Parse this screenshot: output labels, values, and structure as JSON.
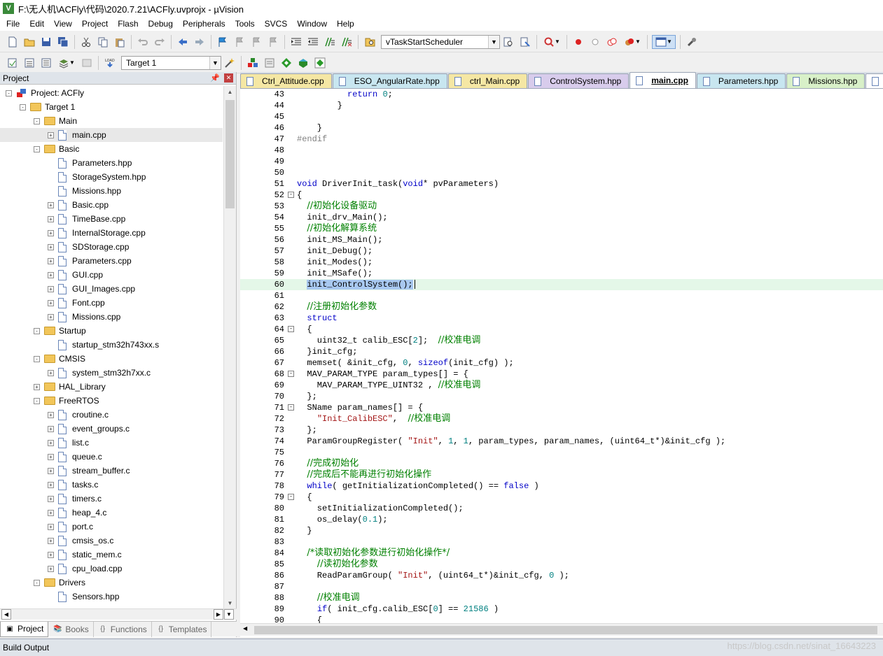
{
  "window": {
    "title": "F:\\无人机\\ACFly\\代码\\2020.7.21\\ACFly.uvprojx - µVision",
    "app_icon": "V"
  },
  "menu": [
    "File",
    "Edit",
    "View",
    "Project",
    "Flash",
    "Debug",
    "Peripherals",
    "Tools",
    "SVCS",
    "Window",
    "Help"
  ],
  "toolbar": {
    "function_combo": "vTaskStartScheduler",
    "target_combo": "Target 1"
  },
  "project_panel": {
    "title": "Project",
    "tabs": [
      "Project",
      "Books",
      "Functions",
      "Templates"
    ],
    "tree": [
      {
        "depth": 0,
        "exp": "-",
        "kind": "project",
        "label": "Project: ACFly"
      },
      {
        "depth": 1,
        "exp": "-",
        "kind": "target",
        "label": "Target 1"
      },
      {
        "depth": 2,
        "exp": "-",
        "kind": "folder",
        "label": "Main"
      },
      {
        "depth": 3,
        "exp": "+",
        "kind": "file",
        "label": "main.cpp",
        "selected": true
      },
      {
        "depth": 2,
        "exp": "-",
        "kind": "folder",
        "label": "Basic"
      },
      {
        "depth": 3,
        "exp": "",
        "kind": "file",
        "label": "Parameters.hpp"
      },
      {
        "depth": 3,
        "exp": "",
        "kind": "file",
        "label": "StorageSystem.hpp"
      },
      {
        "depth": 3,
        "exp": "",
        "kind": "file",
        "label": "Missions.hpp"
      },
      {
        "depth": 3,
        "exp": "+",
        "kind": "file",
        "label": "Basic.cpp"
      },
      {
        "depth": 3,
        "exp": "+",
        "kind": "file",
        "label": "TimeBase.cpp"
      },
      {
        "depth": 3,
        "exp": "+",
        "kind": "file",
        "label": "InternalStorage.cpp"
      },
      {
        "depth": 3,
        "exp": "+",
        "kind": "file",
        "label": "SDStorage.cpp"
      },
      {
        "depth": 3,
        "exp": "+",
        "kind": "file",
        "label": "Parameters.cpp"
      },
      {
        "depth": 3,
        "exp": "+",
        "kind": "file",
        "label": "GUI.cpp"
      },
      {
        "depth": 3,
        "exp": "+",
        "kind": "file",
        "label": "GUI_Images.cpp"
      },
      {
        "depth": 3,
        "exp": "+",
        "kind": "file",
        "label": "Font.cpp"
      },
      {
        "depth": 3,
        "exp": "+",
        "kind": "file",
        "label": "Missions.cpp"
      },
      {
        "depth": 2,
        "exp": "-",
        "kind": "folder",
        "label": "Startup"
      },
      {
        "depth": 3,
        "exp": "",
        "kind": "file",
        "label": "startup_stm32h743xx.s"
      },
      {
        "depth": 2,
        "exp": "-",
        "kind": "folder",
        "label": "CMSIS"
      },
      {
        "depth": 3,
        "exp": "+",
        "kind": "file",
        "label": "system_stm32h7xx.c"
      },
      {
        "depth": 2,
        "exp": "+",
        "kind": "folder",
        "label": "HAL_Library"
      },
      {
        "depth": 2,
        "exp": "-",
        "kind": "folder",
        "label": "FreeRTOS"
      },
      {
        "depth": 3,
        "exp": "+",
        "kind": "file",
        "label": "croutine.c"
      },
      {
        "depth": 3,
        "exp": "+",
        "kind": "file",
        "label": "event_groups.c"
      },
      {
        "depth": 3,
        "exp": "+",
        "kind": "file",
        "label": "list.c"
      },
      {
        "depth": 3,
        "exp": "+",
        "kind": "file",
        "label": "queue.c"
      },
      {
        "depth": 3,
        "exp": "+",
        "kind": "file",
        "label": "stream_buffer.c"
      },
      {
        "depth": 3,
        "exp": "+",
        "kind": "file",
        "label": "tasks.c"
      },
      {
        "depth": 3,
        "exp": "+",
        "kind": "file",
        "label": "timers.c"
      },
      {
        "depth": 3,
        "exp": "+",
        "kind": "file",
        "label": "heap_4.c"
      },
      {
        "depth": 3,
        "exp": "+",
        "kind": "file",
        "label": "port.c"
      },
      {
        "depth": 3,
        "exp": "+",
        "kind": "file",
        "label": "cmsis_os.c"
      },
      {
        "depth": 3,
        "exp": "+",
        "kind": "file",
        "label": "static_mem.c"
      },
      {
        "depth": 3,
        "exp": "+",
        "kind": "file",
        "label": "cpu_load.cpp"
      },
      {
        "depth": 2,
        "exp": "-",
        "kind": "folder",
        "label": "Drivers"
      },
      {
        "depth": 3,
        "exp": "",
        "kind": "file",
        "label": "Sensors.hpp"
      }
    ]
  },
  "editor": {
    "tabs": [
      {
        "label": "Ctrl_Attitude.cpp",
        "color": "#f5e7a4"
      },
      {
        "label": "ESO_AngularRate.hpp",
        "color": "#c8e6f0"
      },
      {
        "label": "ctrl_Main.cpp",
        "color": "#f5e7a4"
      },
      {
        "label": "ControlSystem.hpp",
        "color": "#d8ccec"
      },
      {
        "label": "main.cpp",
        "color": "#ffffff",
        "active": true
      },
      {
        "label": "Parameters.hpp",
        "color": "#c8e6f0"
      },
      {
        "label": "Missions.hpp",
        "color": "#d8f0c8"
      },
      {
        "label": "",
        "color": "#ffffff"
      }
    ],
    "lines": [
      {
        "n": "43",
        "fold": "",
        "segs": [
          [
            "t",
            "          "
          ],
          [
            "kw",
            "return"
          ],
          [
            "t",
            " "
          ],
          [
            "num",
            "0"
          ],
          [
            "t",
            ";"
          ]
        ]
      },
      {
        "n": "44",
        "fold": "",
        "segs": [
          [
            "t",
            "        }"
          ]
        ]
      },
      {
        "n": "45",
        "fold": "",
        "segs": []
      },
      {
        "n": "46",
        "fold": "",
        "segs": [
          [
            "t",
            "    }"
          ]
        ]
      },
      {
        "n": "47",
        "fold": "",
        "segs": [
          [
            "pp",
            "#endif"
          ]
        ]
      },
      {
        "n": "48",
        "fold": "",
        "segs": []
      },
      {
        "n": "49",
        "fold": "",
        "segs": []
      },
      {
        "n": "50",
        "fold": "",
        "segs": []
      },
      {
        "n": "51",
        "fold": "",
        "segs": [
          [
            "kw",
            "void"
          ],
          [
            "t",
            " DriverInit_task("
          ],
          [
            "kw",
            "void"
          ],
          [
            "t",
            "* pvParameters)"
          ]
        ]
      },
      {
        "n": "52",
        "fold": "-",
        "segs": [
          [
            "t",
            "{"
          ]
        ]
      },
      {
        "n": "53",
        "fold": "",
        "segs": [
          [
            "t",
            "  "
          ],
          [
            "com",
            "//初始化设备驱动"
          ]
        ]
      },
      {
        "n": "54",
        "fold": "",
        "segs": [
          [
            "t",
            "  init_drv_Main();"
          ]
        ]
      },
      {
        "n": "55",
        "fold": "",
        "segs": [
          [
            "t",
            "  "
          ],
          [
            "com",
            "//初始化解算系统"
          ]
        ]
      },
      {
        "n": "56",
        "fold": "",
        "segs": [
          [
            "t",
            "  init_MS_Main();"
          ]
        ]
      },
      {
        "n": "57",
        "fold": "",
        "segs": [
          [
            "t",
            "  init_Debug();"
          ]
        ]
      },
      {
        "n": "58",
        "fold": "",
        "segs": [
          [
            "t",
            "  init_Modes();"
          ]
        ]
      },
      {
        "n": "59",
        "fold": "",
        "segs": [
          [
            "t",
            "  init_MSafe();"
          ]
        ]
      },
      {
        "n": "60",
        "fold": "",
        "cur": true,
        "segs": [
          [
            "t",
            "  "
          ],
          [
            "sel",
            "init_ControlSystem();"
          ],
          [
            "caret",
            ""
          ]
        ]
      },
      {
        "n": "61",
        "fold": "",
        "segs": []
      },
      {
        "n": "62",
        "fold": "",
        "segs": [
          [
            "t",
            "  "
          ],
          [
            "com",
            "//注册初始化参数"
          ]
        ]
      },
      {
        "n": "63",
        "fold": "",
        "segs": [
          [
            "t",
            "  "
          ],
          [
            "kw",
            "struct"
          ]
        ]
      },
      {
        "n": "64",
        "fold": "-",
        "segs": [
          [
            "t",
            "  {"
          ]
        ]
      },
      {
        "n": "65",
        "fold": "",
        "segs": [
          [
            "t",
            "    uint32_t calib_ESC["
          ],
          [
            "num",
            "2"
          ],
          [
            "t",
            "];  "
          ],
          [
            "com",
            "//校准电调"
          ]
        ]
      },
      {
        "n": "66",
        "fold": "",
        "segs": [
          [
            "t",
            "  }init_cfg;"
          ]
        ]
      },
      {
        "n": "67",
        "fold": "",
        "segs": [
          [
            "t",
            "  memset( &init_cfg, "
          ],
          [
            "num",
            "0"
          ],
          [
            "t",
            ", "
          ],
          [
            "kw",
            "sizeof"
          ],
          [
            "t",
            "(init_cfg) );"
          ]
        ]
      },
      {
        "n": "68",
        "fold": "-",
        "segs": [
          [
            "t",
            "  MAV_PARAM_TYPE param_types[] = {"
          ]
        ]
      },
      {
        "n": "69",
        "fold": "",
        "segs": [
          [
            "t",
            "    MAV_PARAM_TYPE_UINT32 , "
          ],
          [
            "com",
            "//校准电调"
          ]
        ]
      },
      {
        "n": "70",
        "fold": "",
        "segs": [
          [
            "t",
            "  };"
          ]
        ]
      },
      {
        "n": "71",
        "fold": "-",
        "segs": [
          [
            "t",
            "  SName param_names[] = {"
          ]
        ]
      },
      {
        "n": "72",
        "fold": "",
        "segs": [
          [
            "t",
            "    "
          ],
          [
            "str",
            "\"Init_CalibESC\""
          ],
          [
            "t",
            ",  "
          ],
          [
            "com",
            "//校准电调"
          ]
        ]
      },
      {
        "n": "73",
        "fold": "",
        "segs": [
          [
            "t",
            "  };"
          ]
        ]
      },
      {
        "n": "74",
        "fold": "",
        "segs": [
          [
            "t",
            "  ParamGroupRegister( "
          ],
          [
            "str",
            "\"Init\""
          ],
          [
            "t",
            ", "
          ],
          [
            "num",
            "1"
          ],
          [
            "t",
            ", "
          ],
          [
            "num",
            "1"
          ],
          [
            "t",
            ", param_types, param_names, (uint64_t*)&init_cfg );"
          ]
        ]
      },
      {
        "n": "75",
        "fold": "",
        "segs": []
      },
      {
        "n": "76",
        "fold": "",
        "segs": [
          [
            "t",
            "  "
          ],
          [
            "com",
            "//完成初始化"
          ]
        ]
      },
      {
        "n": "77",
        "fold": "",
        "segs": [
          [
            "t",
            "  "
          ],
          [
            "com",
            "//完成后不能再进行初始化操作"
          ]
        ]
      },
      {
        "n": "78",
        "fold": "",
        "segs": [
          [
            "t",
            "  "
          ],
          [
            "kw",
            "while"
          ],
          [
            "t",
            "( getInitializationCompleted() == "
          ],
          [
            "kw",
            "false"
          ],
          [
            "t",
            " )"
          ]
        ]
      },
      {
        "n": "79",
        "fold": "-",
        "segs": [
          [
            "t",
            "  {"
          ]
        ]
      },
      {
        "n": "80",
        "fold": "",
        "segs": [
          [
            "t",
            "    setInitializationCompleted();"
          ]
        ]
      },
      {
        "n": "81",
        "fold": "",
        "segs": [
          [
            "t",
            "    os_delay("
          ],
          [
            "num",
            "0.1"
          ],
          [
            "t",
            ");"
          ]
        ]
      },
      {
        "n": "82",
        "fold": "",
        "segs": [
          [
            "t",
            "  }"
          ]
        ]
      },
      {
        "n": "83",
        "fold": "",
        "segs": []
      },
      {
        "n": "84",
        "fold": "",
        "segs": [
          [
            "t",
            "  "
          ],
          [
            "com",
            "/*读取初始化参数进行初始化操作*/"
          ]
        ]
      },
      {
        "n": "85",
        "fold": "",
        "segs": [
          [
            "t",
            "    "
          ],
          [
            "com",
            "//读初始化参数"
          ]
        ]
      },
      {
        "n": "86",
        "fold": "",
        "segs": [
          [
            "t",
            "    ReadParamGroup( "
          ],
          [
            "str",
            "\"Init\""
          ],
          [
            "t",
            ", (uint64_t*)&init_cfg, "
          ],
          [
            "num",
            "0"
          ],
          [
            "t",
            " );"
          ]
        ]
      },
      {
        "n": "87",
        "fold": "",
        "segs": []
      },
      {
        "n": "88",
        "fold": "",
        "segs": [
          [
            "t",
            "    "
          ],
          [
            "com",
            "//校准电调"
          ]
        ]
      },
      {
        "n": "89",
        "fold": "",
        "segs": [
          [
            "t",
            "    "
          ],
          [
            "kw",
            "if"
          ],
          [
            "t",
            "( init_cfg.calib_ESC["
          ],
          [
            "num",
            "0"
          ],
          [
            "t",
            "] == "
          ],
          [
            "num",
            "21586"
          ],
          [
            "t",
            " )"
          ]
        ]
      },
      {
        "n": "90",
        "fold": "",
        "segs": [
          [
            "t",
            "    {"
          ]
        ]
      }
    ]
  },
  "build_output": {
    "title": "Build Output"
  },
  "watermark": "https://blog.csdn.net/sinat_16643223"
}
